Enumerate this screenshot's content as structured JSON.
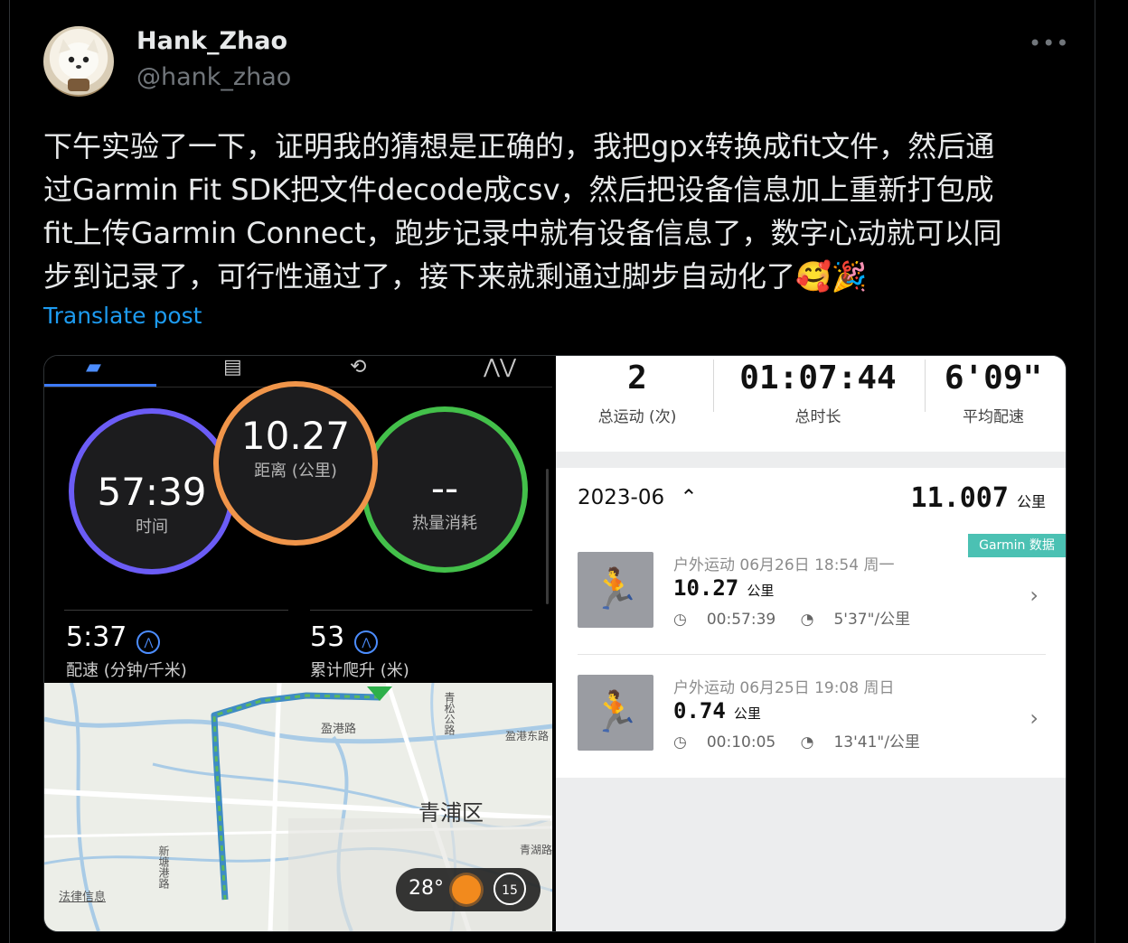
{
  "tweet": {
    "author_name": "Hank_Zhao",
    "author_handle": "@hank_zhao",
    "more_label": "•••",
    "lines": [
      "下午实验了一下，证明我的猜想是正确的，我把gpx转换成fit文件，然后通",
      "过Garmin Fit SDK把文件decode成csv，然后把设备信息加上重新打包成",
      "fit上传Garmin Connect，跑步记录中就有设备信息了，数字心动就可以同",
      "步到记录了，可行性通过了，接下来就剩通过脚步自动化了🥰🎉"
    ],
    "translate_label": "Translate post"
  },
  "left_app": {
    "tab_icons": [
      "activity-icon",
      "list-icon",
      "repeat-icon",
      "chart-icon"
    ],
    "rings": {
      "time": {
        "value": "57:39",
        "label": "时间"
      },
      "distance": {
        "value": "10.27",
        "label": "距离 (公里)"
      },
      "calories": {
        "value": "--",
        "label": "热量消耗"
      }
    },
    "stats": [
      {
        "value": "5:37",
        "label": "配速 (分钟/千米)"
      },
      {
        "value": "53",
        "label": "累计爬升 (米)"
      }
    ],
    "map": {
      "district": "青浦区",
      "roads": [
        "盈港路",
        "盈港东路",
        "青松公路",
        "新塘港路",
        "青湖路"
      ],
      "legal": "法律信息",
      "weather_temp": "28°",
      "clock_value": "15"
    }
  },
  "right_app": {
    "summary": [
      {
        "value": "2",
        "label": "总运动 (次)"
      },
      {
        "value": "01:07:44",
        "label": "总时长"
      },
      {
        "value": "6'09\"",
        "label": "平均配速"
      }
    ],
    "month": {
      "label": "2023-06",
      "total": "11.007",
      "unit": "公里",
      "badge": "Garmin 数据"
    },
    "records": [
      {
        "meta": "户外运动  06月26日 18:54 周一",
        "distance": "10.27",
        "unit": "公里",
        "duration": "00:57:39",
        "pace": "5'37\"/公里"
      },
      {
        "meta": "户外运动  06月25日 19:08 周日",
        "distance": "0.74",
        "unit": "公里",
        "duration": "00:10:05",
        "pace": "13'41\"/公里"
      }
    ]
  },
  "colors": {
    "link": "#1d9bf0",
    "badge": "#4bc1b3",
    "ring_time": "#6b5cf6",
    "ring_distance": "#f0954a",
    "ring_calories": "#43c04a"
  }
}
